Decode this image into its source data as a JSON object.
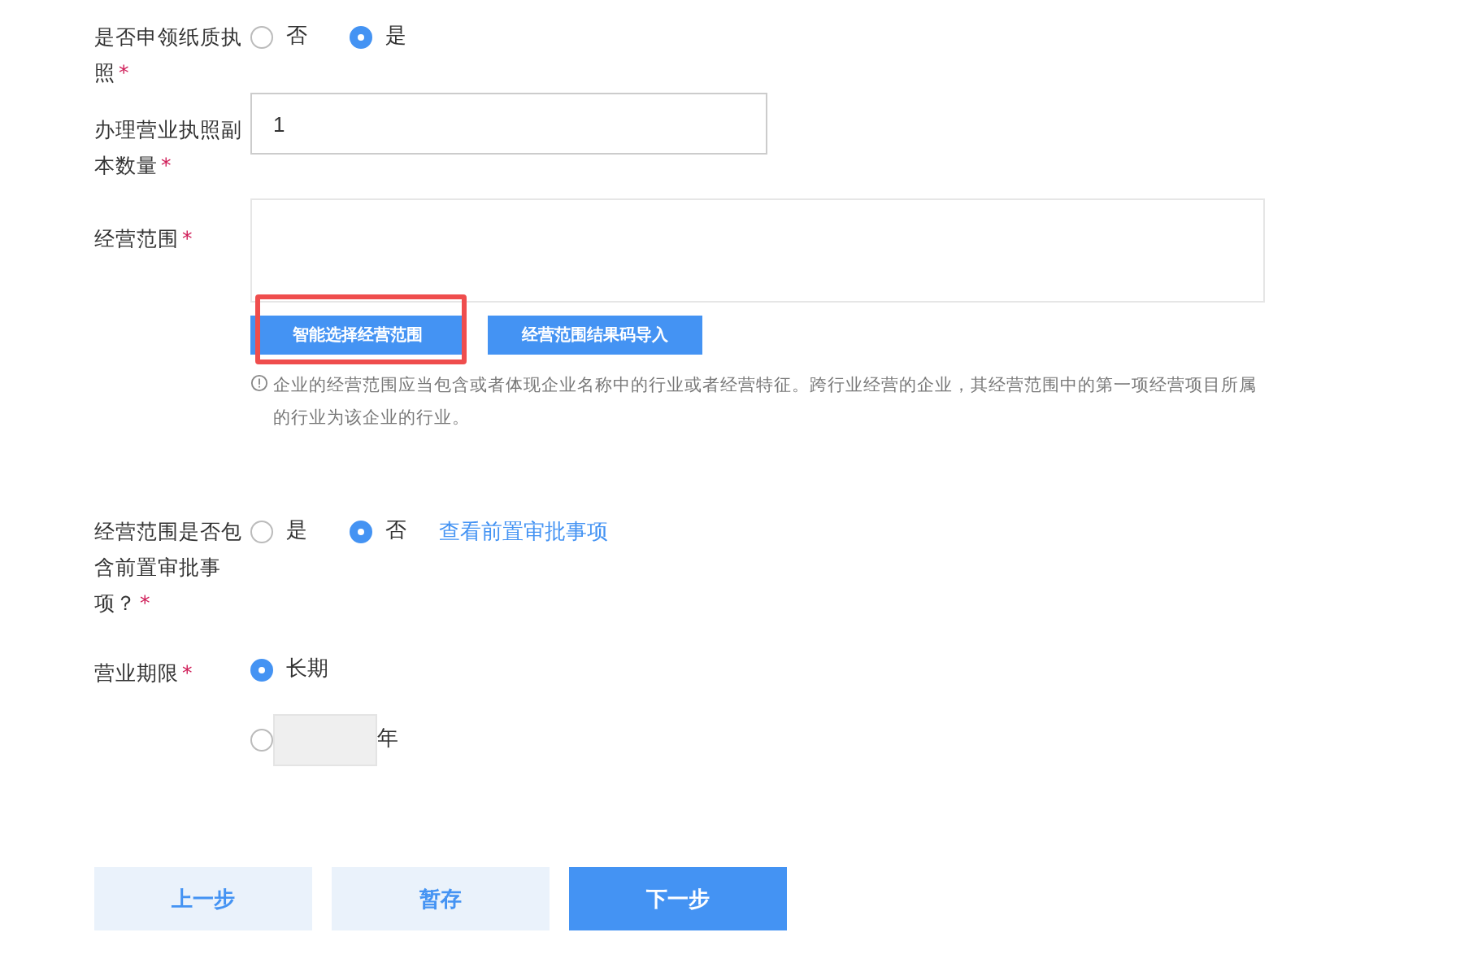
{
  "fields": [
    {
      "kind": "radio",
      "label": "是否申领纸质执照",
      "required_mark": "*",
      "options": [
        {
          "label": "否",
          "selected": false
        },
        {
          "label": "是",
          "selected": true
        }
      ]
    },
    {
      "kind": "input",
      "label": "办理营业执照副本数量",
      "required_mark": "*",
      "value": "1"
    },
    {
      "kind": "scope",
      "label": "经营范围",
      "required_mark": "*",
      "buttons": [
        {
          "label": "智能选择经营范围",
          "highlighted": true
        },
        {
          "label": "经营范围结果码导入",
          "highlighted": false
        }
      ],
      "hint": "企业的经营范围应当包含或者体现企业名称中的行业或者经营特征。跨行业经营的企业，其经营范围中的第一项经营项目所属的行业为该企业的行业。"
    },
    {
      "kind": "radio",
      "label": "经营范围是否包含前置审批事项？",
      "required_mark": "*",
      "options": [
        {
          "label": "是",
          "selected": false
        },
        {
          "label": "否",
          "selected": true
        }
      ],
      "link": "查看前置审批事项"
    },
    {
      "kind": "period",
      "label": "营业期限",
      "required_mark": "*",
      "options": [
        {
          "label": "长期",
          "selected": true
        },
        {
          "label": "年",
          "selected": false
        }
      ]
    }
  ],
  "actions": [
    {
      "label": "上一步",
      "primary": false
    },
    {
      "label": "暂存",
      "primary": false
    },
    {
      "label": "下一步",
      "primary": true
    }
  ]
}
